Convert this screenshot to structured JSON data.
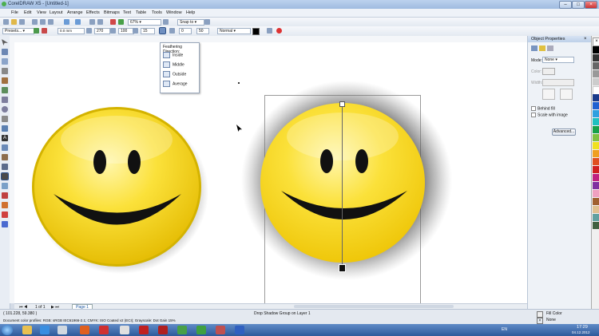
{
  "window": {
    "title": "CorelDRAW X5 - [Untitled-1]"
  },
  "menu": [
    "File",
    "Edit",
    "View",
    "Layout",
    "Arrange",
    "Effects",
    "Bitmaps",
    "Text",
    "Table",
    "Tools",
    "Window",
    "Help"
  ],
  "toolbar1": {
    "zoom": "67%",
    "snap": "Snap to"
  },
  "toolbar2": {
    "preset": "Presets...",
    "x_field": "0.0 mm",
    "y_field": "0.0 mm",
    "angle": "270",
    "opacity": "100",
    "feather": "15",
    "fade": "0",
    "stretch": "50",
    "color_count": "100",
    "blend": "Normal"
  },
  "feather_popup": {
    "title": "Feathering Direction:",
    "items": [
      "Inside",
      "Middle",
      "Outside",
      "Average"
    ]
  },
  "docker": {
    "title": "Object Properties",
    "mode_label": "Mode:",
    "mode_value": "None",
    "color_label": "Color:",
    "width_label": "Width:",
    "behind_fill": "Behind fill",
    "scale_with_image": "Scale with image",
    "advanced_button": "Advanced..."
  },
  "page_nav": {
    "counter": "1 of 1",
    "page_tab": "Page 1"
  },
  "status": {
    "coords": "( 101.228, 59.380 )",
    "selection": "Drop Shadow Group on Layer 1",
    "profile": "Document color profiles: RGB: sRGB IEC61966-2.1; CMYK: ISO Coated v2 (ECI); Grayscale: Dot Gain 15%",
    "fill_label": "Fill Color",
    "outline_label": "None"
  },
  "tray": {
    "lang": "EN",
    "time": "17:29",
    "date": "04.12.2012"
  },
  "colors": {
    "smiley": "#f8d71a",
    "smiley_edge": "#c9a900",
    "accent": "#2e5a9a"
  }
}
